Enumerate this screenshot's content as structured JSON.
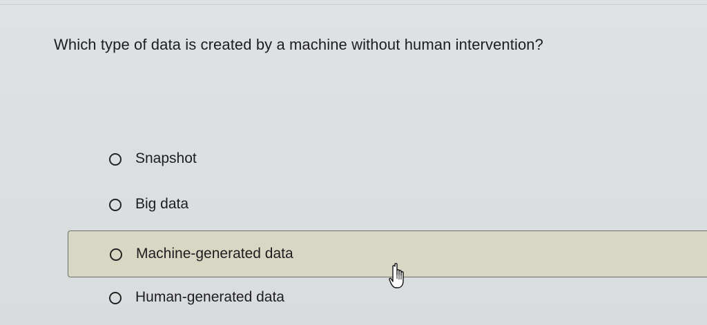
{
  "question": {
    "text": "Which type of data is created by a machine without human intervention?"
  },
  "options": [
    {
      "label": "Snapshot",
      "hovered": false
    },
    {
      "label": "Big data",
      "hovered": false
    },
    {
      "label": "Machine-generated data",
      "hovered": true
    },
    {
      "label": "Human-generated data",
      "hovered": false
    }
  ],
  "cursor": {
    "icon": "hand-pointer-icon"
  },
  "colors": {
    "background": "#dcdfe1",
    "hover_fill": "#d8d7c4",
    "hover_border": "#6f6f68",
    "text": "#1d1d1f"
  }
}
